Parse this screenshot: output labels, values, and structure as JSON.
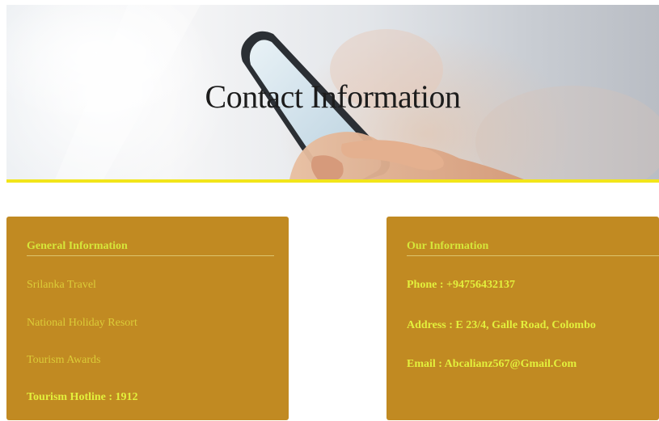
{
  "banner": {
    "title": "Contact Information",
    "accent_color": "#f2e51a"
  },
  "general_info": {
    "heading": "General Information",
    "items": [
      "Srilanka Travel",
      "National Holiday Resort",
      "Tourism Awards"
    ],
    "hotline": "Tourism Hotline : 1912"
  },
  "our_info": {
    "heading": "Our Information",
    "phone": "Phone : +94756432137",
    "address": "Address : E 23/4, Galle Road, Colombo",
    "email": "Email : Abcalianz567@Gmail.Com"
  },
  "colors": {
    "card_background": "#c18a22",
    "heading_text": "#d6e63a"
  }
}
